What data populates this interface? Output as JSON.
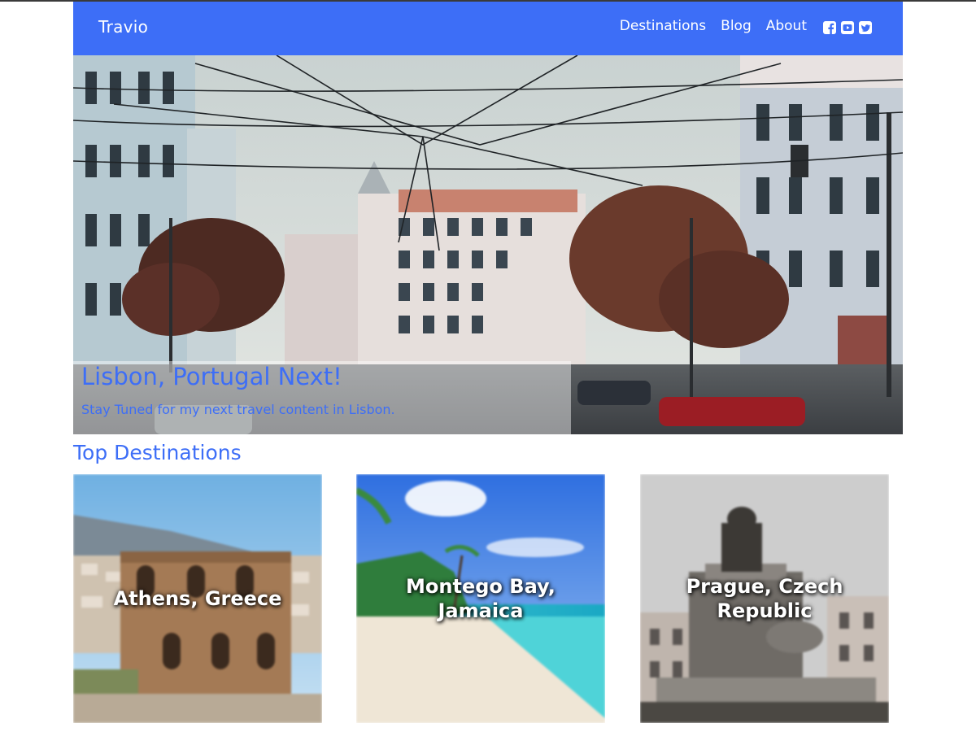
{
  "header": {
    "brand": "Travio",
    "nav": [
      "Destinations",
      "Blog",
      "About"
    ],
    "social_icons": [
      "facebook-icon",
      "youtube-icon",
      "twitter-icon"
    ],
    "accent_color": "#3d6ef7"
  },
  "hero": {
    "title": "Lisbon, Portugal Next!",
    "subtitle": "Stay Tuned for my next travel content in Lisbon."
  },
  "destinations": {
    "heading": "Top Destinations",
    "cards": [
      {
        "label": "Athens, Greece"
      },
      {
        "label_line1": "Montego Bay,",
        "label_line2": "Jamaica"
      },
      {
        "label_line1": "Prague, Czech",
        "label_line2": "Republic"
      }
    ]
  }
}
